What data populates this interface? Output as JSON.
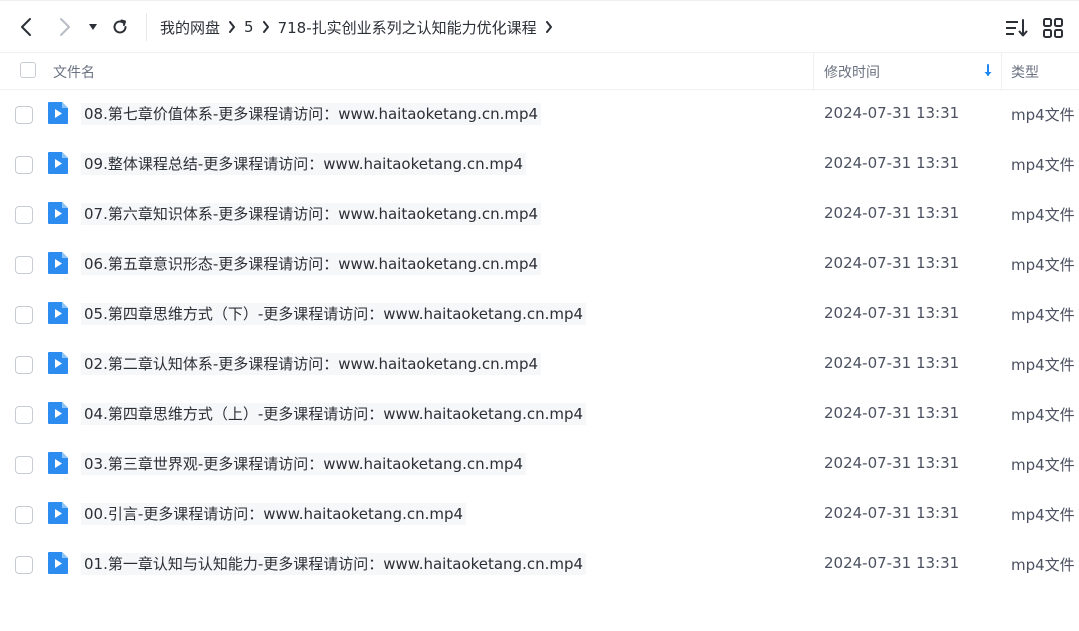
{
  "breadcrumb": {
    "items": [
      "我的网盘",
      "5",
      "718-扎实创业系列之认知能力优化课程"
    ]
  },
  "toolbar": {
    "back_icon": "chevron-left-icon",
    "forward_icon": "chevron-right-icon",
    "history_icon": "caret-down-icon",
    "refresh_icon": "refresh-icon",
    "sort_icon": "sort-list-icon",
    "grid_icon": "grid-view-icon"
  },
  "columns": {
    "name": "文件名",
    "time": "修改时间",
    "type": "类型"
  },
  "colors": {
    "accent": "#1e88f0",
    "file_icon": "#2d8cf0"
  },
  "files": [
    {
      "name": "08.第七章价值体系-更多课程请访问：www.haitaoketang.cn.mp4",
      "time": "2024-07-31 13:31",
      "type": "mp4文件"
    },
    {
      "name": "09.整体课程总结-更多课程请访问：www.haitaoketang.cn.mp4",
      "time": "2024-07-31 13:31",
      "type": "mp4文件"
    },
    {
      "name": "07.第六章知识体系-更多课程请访问：www.haitaoketang.cn.mp4",
      "time": "2024-07-31 13:31",
      "type": "mp4文件"
    },
    {
      "name": "06.第五章意识形态-更多课程请访问：www.haitaoketang.cn.mp4",
      "time": "2024-07-31 13:31",
      "type": "mp4文件"
    },
    {
      "name": "05.第四章思维方式（下）-更多课程请访问：www.haitaoketang.cn.mp4",
      "time": "2024-07-31 13:31",
      "type": "mp4文件"
    },
    {
      "name": "02.第二章认知体系-更多课程请访问：www.haitaoketang.cn.mp4",
      "time": "2024-07-31 13:31",
      "type": "mp4文件"
    },
    {
      "name": "04.第四章思维方式（上）-更多课程请访问：www.haitaoketang.cn.mp4",
      "time": "2024-07-31 13:31",
      "type": "mp4文件"
    },
    {
      "name": "03.第三章世界观-更多课程请访问：www.haitaoketang.cn.mp4",
      "time": "2024-07-31 13:31",
      "type": "mp4文件"
    },
    {
      "name": "00.引言-更多课程请访问：www.haitaoketang.cn.mp4",
      "time": "2024-07-31 13:31",
      "type": "mp4文件"
    },
    {
      "name": "01.第一章认知与认知能力-更多课程请访问：www.haitaoketang.cn.mp4",
      "time": "2024-07-31 13:31",
      "type": "mp4文件"
    }
  ]
}
